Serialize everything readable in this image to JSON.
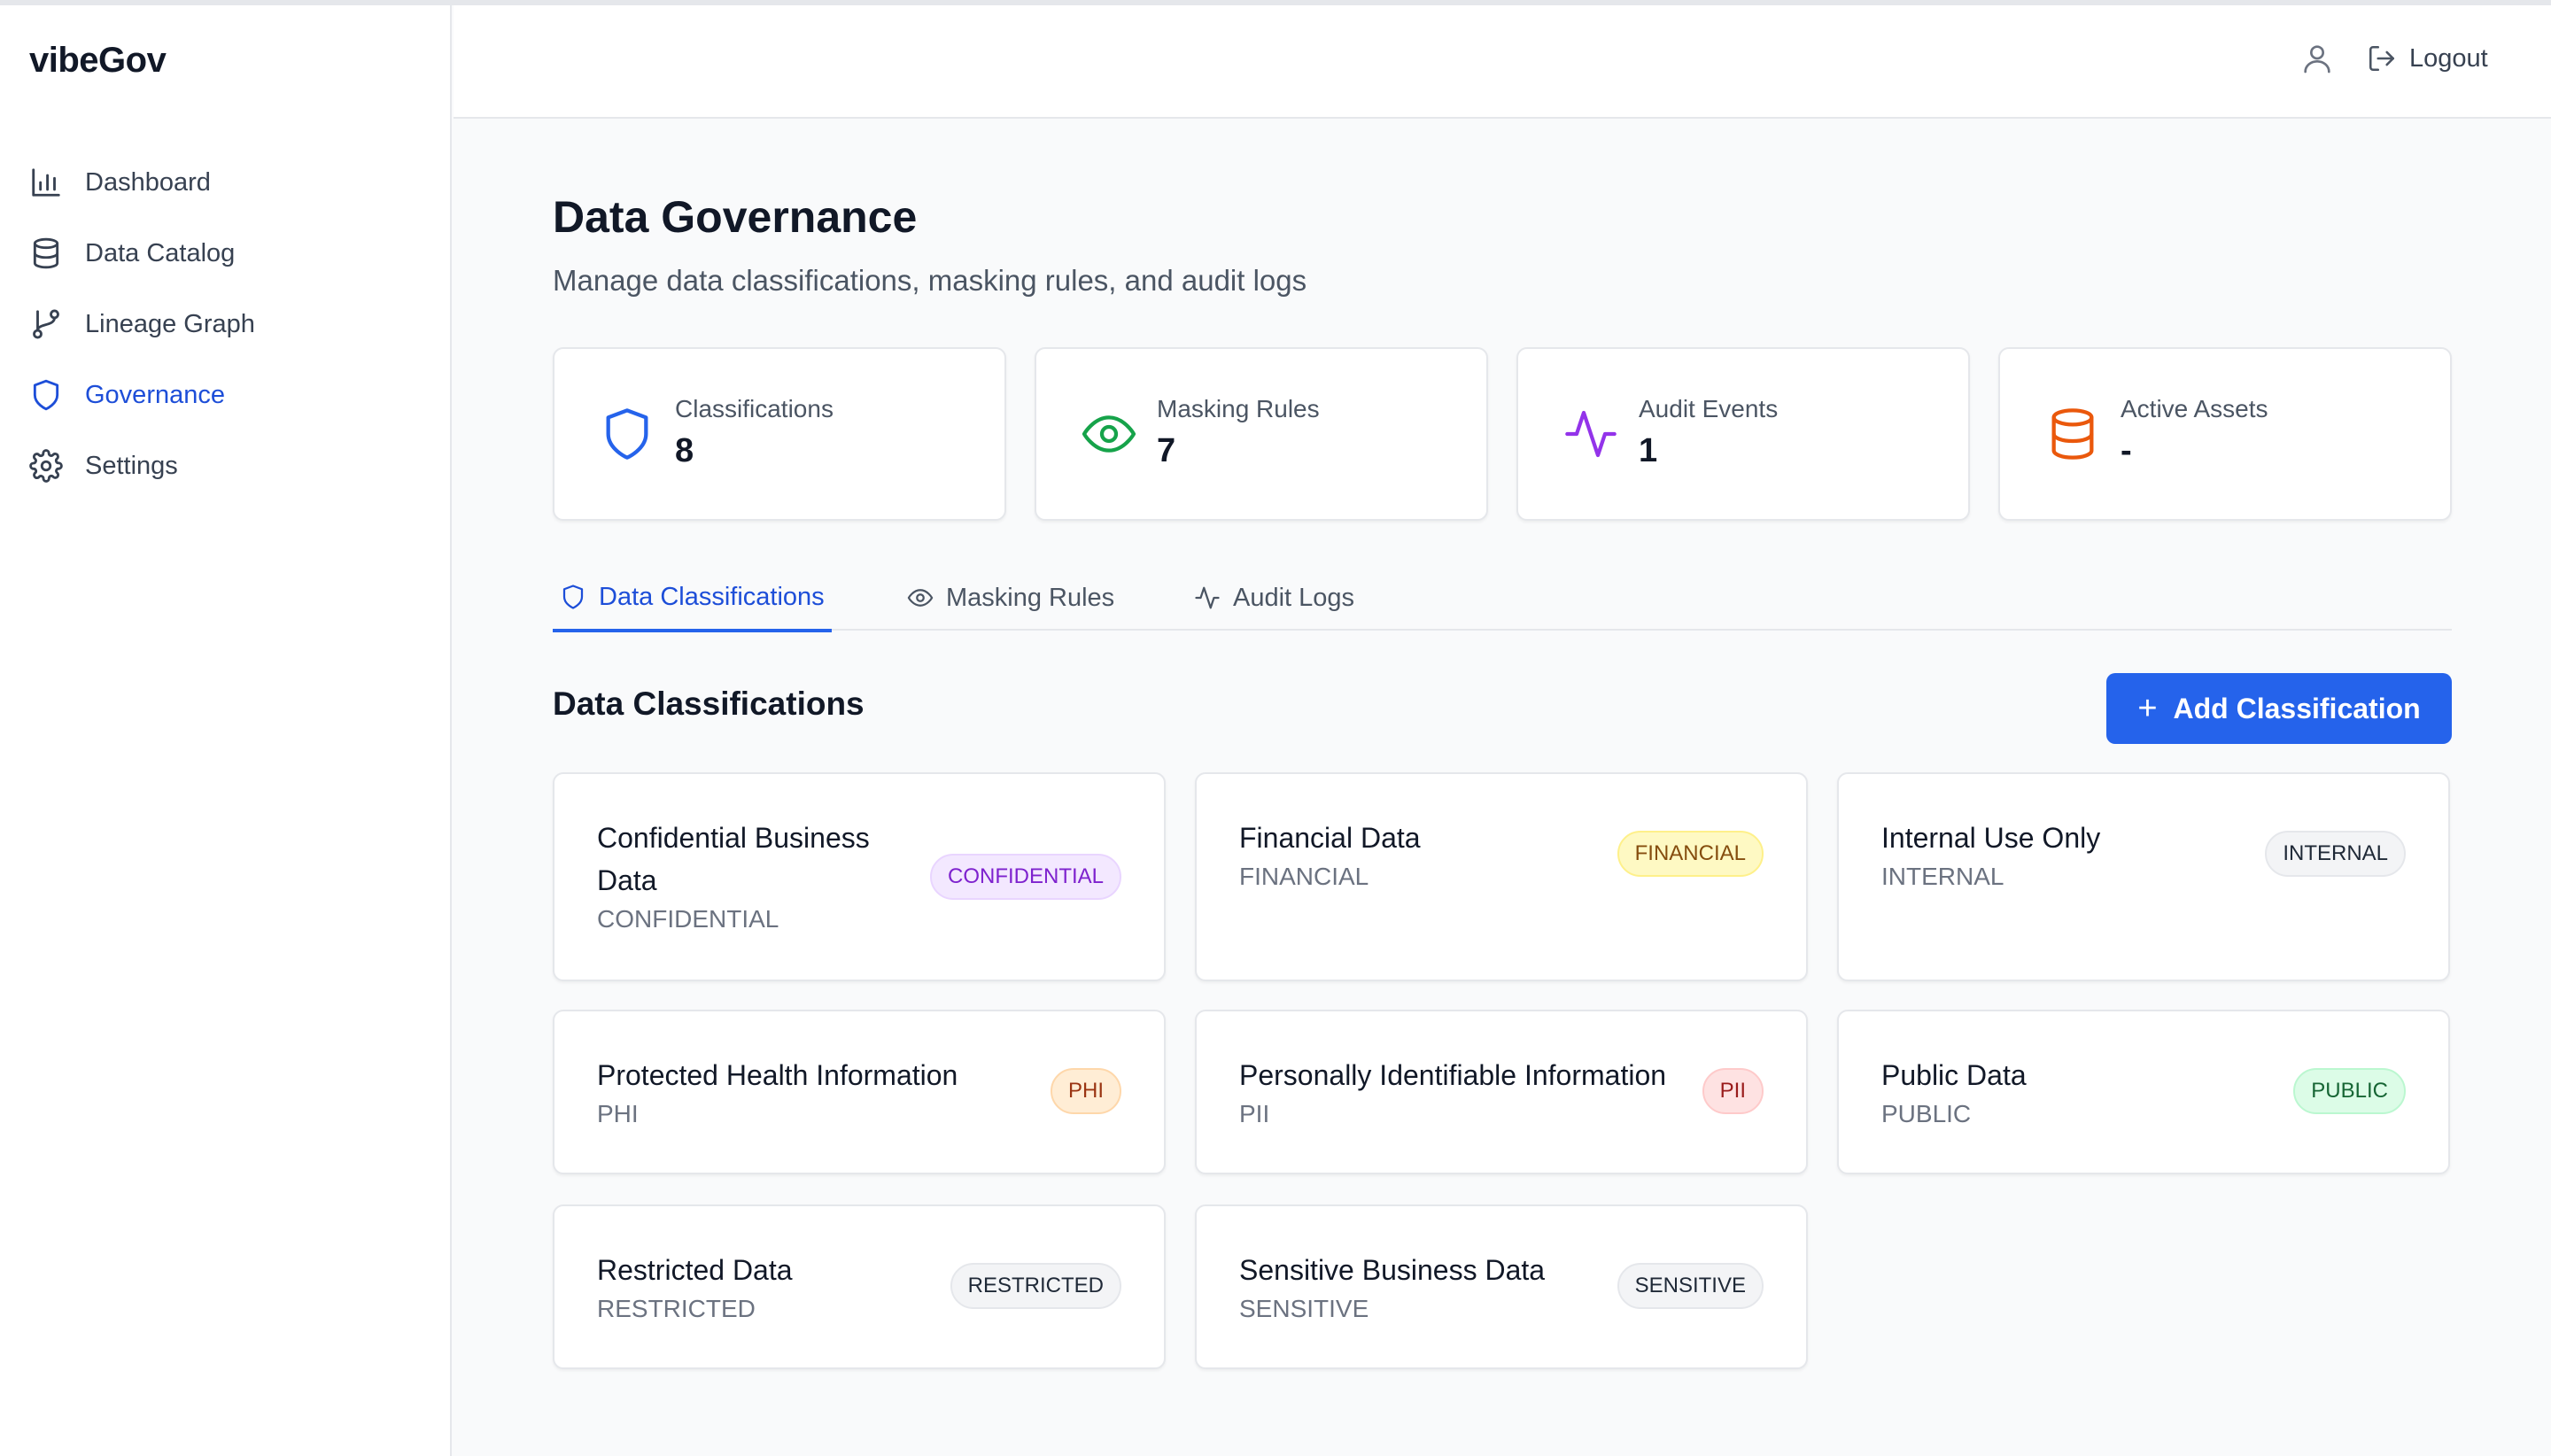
{
  "app": {
    "brand": "vibeGov"
  },
  "sidebar": {
    "items": [
      {
        "label": "Dashboard",
        "icon": "bar-chart-icon",
        "active": false
      },
      {
        "label": "Data Catalog",
        "icon": "database-icon",
        "active": false
      },
      {
        "label": "Lineage Graph",
        "icon": "git-branch-icon",
        "active": false
      },
      {
        "label": "Governance",
        "icon": "shield-icon",
        "active": true
      },
      {
        "label": "Settings",
        "icon": "gear-icon",
        "active": false
      }
    ]
  },
  "header": {
    "user_icon": "user-icon",
    "logout_label": "Logout"
  },
  "page": {
    "title": "Data Governance",
    "subtitle": "Manage data classifications, masking rules, and audit logs"
  },
  "stats": [
    {
      "label": "Classifications",
      "value": "8",
      "icon": "shield-icon",
      "color": "#2563eb"
    },
    {
      "label": "Masking Rules",
      "value": "7",
      "icon": "eye-icon",
      "color": "#16a34a"
    },
    {
      "label": "Audit Events",
      "value": "1",
      "icon": "activity-icon",
      "color": "#9333ea"
    },
    {
      "label": "Active Assets",
      "value": "-",
      "icon": "database-icon",
      "color": "#ea580c"
    }
  ],
  "tabs": [
    {
      "label": "Data Classifications",
      "icon": "shield-icon",
      "active": true
    },
    {
      "label": "Masking Rules",
      "icon": "eye-icon",
      "active": false
    },
    {
      "label": "Audit Logs",
      "icon": "activity-icon",
      "active": false
    }
  ],
  "section": {
    "title": "Data Classifications",
    "add_label": "Add Classification"
  },
  "classifications": [
    {
      "name": "Confidential Business Data",
      "code": "CONFIDENTIAL",
      "badge": "CONFIDENTIAL",
      "badge_bg": "#f3e8ff",
      "badge_fg": "#7e22ce",
      "badge_border": "#e9d5ff"
    },
    {
      "name": "Financial Data",
      "code": "FINANCIAL",
      "badge": "FINANCIAL",
      "badge_bg": "#fef9c3",
      "badge_fg": "#854d0e",
      "badge_border": "#fef08a"
    },
    {
      "name": "Internal Use Only",
      "code": "INTERNAL",
      "badge": "INTERNAL",
      "badge_bg": "#f3f4f6",
      "badge_fg": "#1f2937",
      "badge_border": "#e5e7eb"
    },
    {
      "name": "Protected Health Information",
      "code": "PHI",
      "badge": "PHI",
      "badge_bg": "#ffedd5",
      "badge_fg": "#9a3412",
      "badge_border": "#fed7aa"
    },
    {
      "name": "Personally Identifiable Information",
      "code": "PII",
      "badge": "PII",
      "badge_bg": "#fee2e2",
      "badge_fg": "#991b1b",
      "badge_border": "#fecaca"
    },
    {
      "name": "Public Data",
      "code": "PUBLIC",
      "badge": "PUBLIC",
      "badge_bg": "#dcfce7",
      "badge_fg": "#166534",
      "badge_border": "#bbf7d0"
    },
    {
      "name": "Restricted Data",
      "code": "RESTRICTED",
      "badge": "RESTRICTED",
      "badge_bg": "#f3f4f6",
      "badge_fg": "#1f2937",
      "badge_border": "#e5e7eb"
    },
    {
      "name": "Sensitive Business Data",
      "code": "SENSITIVE",
      "badge": "SENSITIVE",
      "badge_bg": "#f3f4f6",
      "badge_fg": "#1f2937",
      "badge_border": "#e5e7eb"
    }
  ]
}
